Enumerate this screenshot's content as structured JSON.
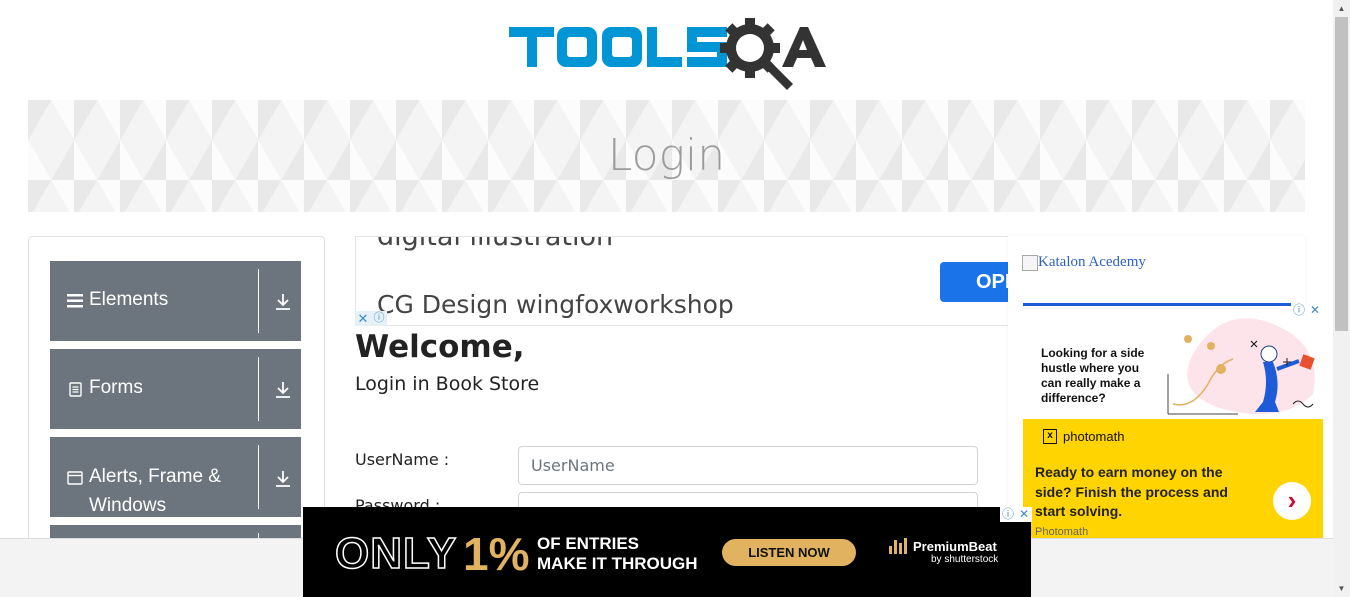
{
  "header": {
    "logo_text": "TOOLSQA",
    "page_title": "Login"
  },
  "sidebar": {
    "groups": [
      {
        "label": "Elements",
        "icon": "hamburger-icon"
      },
      {
        "label": "Forms",
        "icon": "document-icon"
      },
      {
        "label": "Alerts, Frame &",
        "label2": "Windows",
        "icon": "window-icon"
      }
    ]
  },
  "top_ad": {
    "line1": "digital illustration",
    "line2": "CG Design wingfoxworkshop",
    "button": "OPEN"
  },
  "login": {
    "welcome": "Welcome,",
    "subtitle": "Login in Book Store",
    "username_label": "UserName :",
    "username_placeholder": "UserName",
    "password_label": "Password :"
  },
  "right_ad": {
    "katalon": "Katalon Acedemy",
    "headline": "Looking for a side hustle where you can really make a difference?",
    "brand": "photomath",
    "body": "Ready to earn money on the side? Finish the process and start solving.",
    "footer": "Photomath"
  },
  "bottom_ad": {
    "only": "ONLY",
    "pct": "1%",
    "text1": "OF ENTRIES",
    "text2": "MAKE IT THROUGH",
    "button": "LISTEN NOW",
    "brand1": "PremiumBeat",
    "brand2": "by shutterstock"
  },
  "colors": {
    "logo_blue": "#0096d6",
    "logo_dark": "#333333",
    "sidebar_gray": "#6c757d",
    "accent_gold": "#e1b25f",
    "photomath_yellow": "#ffd400"
  }
}
